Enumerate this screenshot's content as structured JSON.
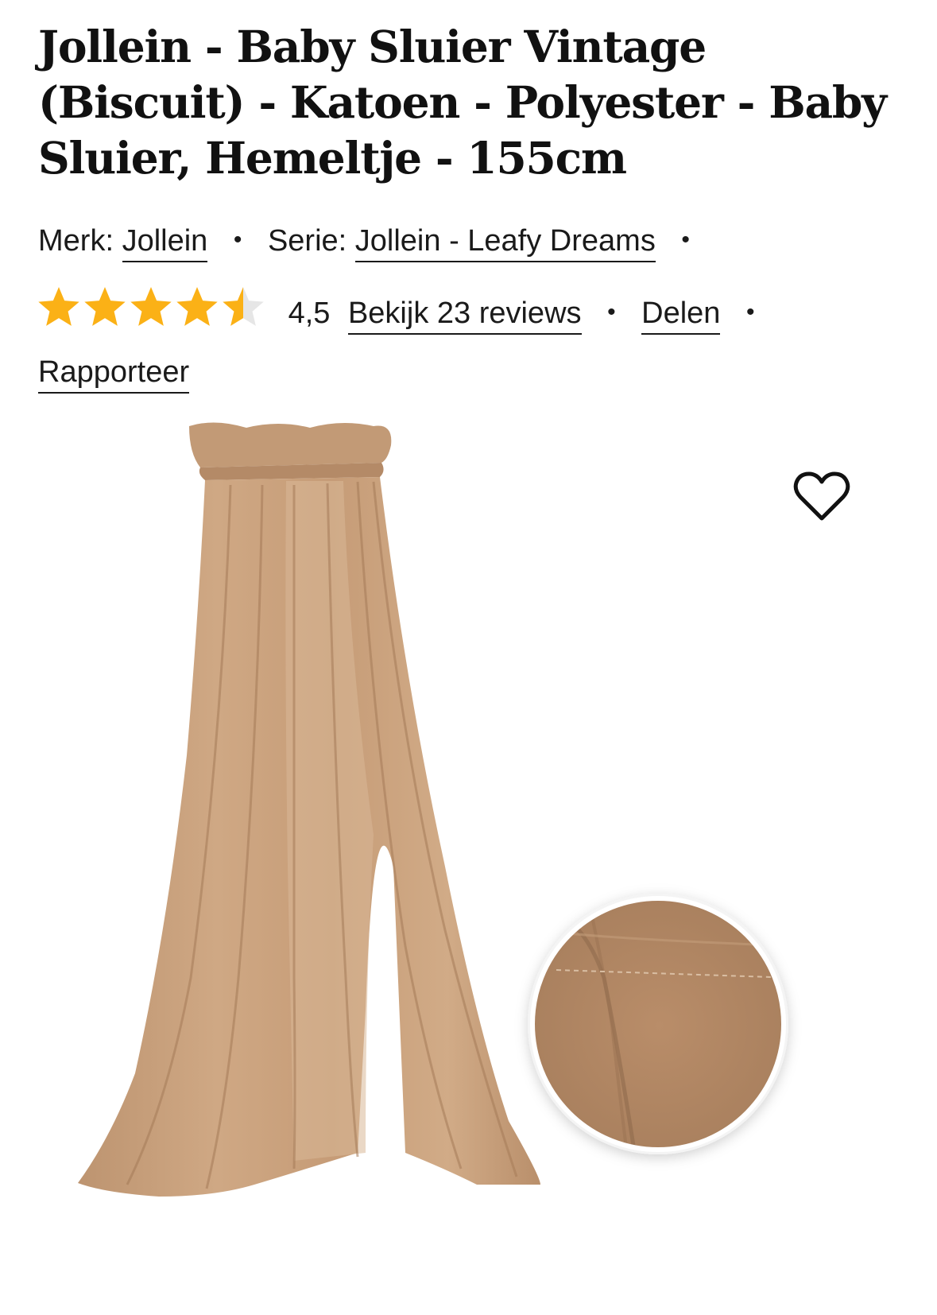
{
  "product": {
    "title": "Jollein - Baby Sluier Vintage (Biscuit) - Katoen - Polyester - Baby Sluier, Hemeltje - 155cm",
    "brand_label": "Merk:",
    "brand": "Jollein",
    "series_label": "Serie:",
    "series": "Jollein - Leafy Dreams",
    "rating_value": "4,5",
    "rating": 4.5,
    "rating_max": 5,
    "reviews_link": "Bekijk 23 reviews",
    "share_link": "Delen",
    "report_link": "Rapporteer",
    "separator": "•"
  },
  "icons": {
    "favorite": "heart-outline-icon",
    "star": "star-icon"
  },
  "colors": {
    "star_fill": "#fbb116",
    "star_empty": "#e6e6e6",
    "fabric": "#c9a07c",
    "fabric_dark": "#a8805f",
    "text": "#111111"
  }
}
